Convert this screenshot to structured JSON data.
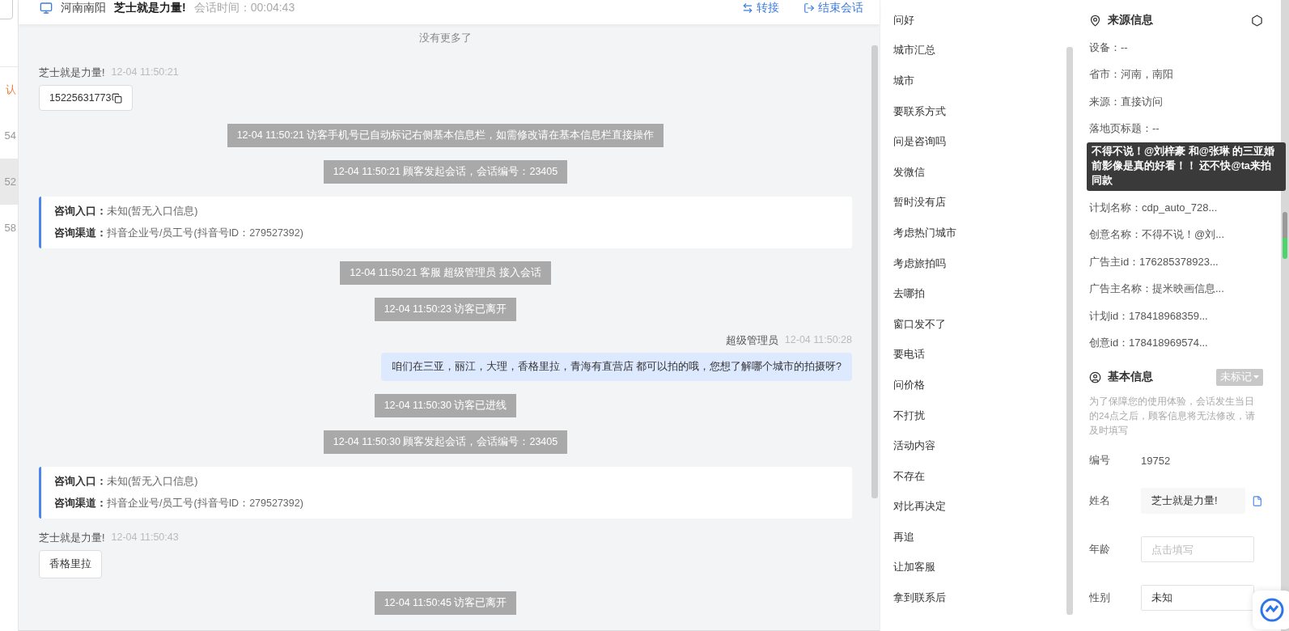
{
  "left_list": {
    "items": [
      {
        "text": "认",
        "kind": "alert",
        "selected": false
      },
      {
        "text": "54",
        "kind": "plain",
        "selected": false
      },
      {
        "text": "52",
        "kind": "plain",
        "selected": true
      },
      {
        "text": "58",
        "kind": "plain",
        "selected": false
      }
    ]
  },
  "header": {
    "location": "河南南阳",
    "customer": "芝士就是力量!",
    "duration": "会话时间：00:04:43",
    "actions": [
      {
        "label": "转接",
        "kind": "transfer"
      },
      {
        "label": "结束会话",
        "kind": "end"
      }
    ]
  },
  "messages": [
    {
      "kind": "notice",
      "text": "没有更多了"
    },
    {
      "kind": "visitor",
      "name": "芝士就是力量!",
      "time": "12-04 11:50:21",
      "text": "15225631773",
      "copy": true
    },
    {
      "kind": "system",
      "text": "12-04 11:50:21 访客手机号已自动标记右侧基本信息栏，如需修改请在基本信息栏直接操作"
    },
    {
      "kind": "system",
      "text": "12-04 11:50:21 顾客发起会话，会话编号：23405"
    },
    {
      "kind": "info",
      "rows": [
        {
          "label": "咨询入口：",
          "value": "未知(暂无入口信息)"
        },
        {
          "label": "咨询渠道：",
          "value": "抖音企业号/员工号(抖音号ID：279527392)"
        }
      ]
    },
    {
      "kind": "system",
      "text": "12-04 11:50:21 客服 超级管理员 接入会话"
    },
    {
      "kind": "system",
      "text": "12-04 11:50:23 访客已离开"
    },
    {
      "kind": "agent",
      "name": "超级管理员",
      "time": "12-04 11:50:28",
      "text": "咱们在三亚，丽江，大理，香格里拉，青海有直营店 都可以拍的哦，您想了解哪个城市的拍摄呀?"
    },
    {
      "kind": "system",
      "text": "12-04 11:50:30 访客已进线"
    },
    {
      "kind": "system",
      "text": "12-04 11:50:30 顾客发起会话，会话编号：23405"
    },
    {
      "kind": "info",
      "rows": [
        {
          "label": "咨询入口：",
          "value": "未知(暂无入口信息)"
        },
        {
          "label": "咨询渠道：",
          "value": "抖音企业号/员工号(抖音号ID：279527392)"
        }
      ]
    },
    {
      "kind": "visitor",
      "name": "芝士就是力量!",
      "time": "12-04 11:50:43",
      "text": "香格里拉",
      "copy": false
    },
    {
      "kind": "system",
      "text": "12-04 11:50:45 访客已离开"
    }
  ],
  "quick_replies": [
    "问好",
    "城市汇总",
    "城市",
    "要联系方式",
    "问是咨询吗",
    "发微信",
    "暂时没有店",
    "考虑热门城市",
    "考虑旅拍吗",
    "去哪拍",
    "窗口发不了",
    "要电话",
    "问价格",
    "不打扰",
    "活动内容",
    "不存在",
    "对比再决定",
    "再追",
    "让加客服",
    "拿到联系后"
  ],
  "source_info": {
    "title": "来源信息",
    "rows": [
      "设备：--",
      "省市：河南，南阳",
      "来源：直接访问",
      "落地页标题：--",
      "计划名称：cdp_auto_728...",
      "创意名称：不得不说！@刘...",
      "广告主id：176285378923...",
      "广告主名称：提米映画信息...",
      "计划id：178418968359...",
      "创意id：178418969574..."
    ],
    "tooltip": "不得不说！@刘梓豪 和@张琳 的三亚婚前影像是真的好看！！ 还不快@ta来拍同款"
  },
  "basic_info": {
    "title": "基本信息",
    "tag": "未标记",
    "note": "为了保障您的使用体验，会话发生当日的24点之后，顾客信息将无法修改，请及时填写",
    "fields": [
      {
        "label": "编号",
        "kind": "static",
        "value": "19752"
      },
      {
        "label": "姓名",
        "kind": "readonly",
        "value": "芝士就是力量!"
      },
      {
        "label": "年龄",
        "kind": "input",
        "placeholder": "点击填写"
      },
      {
        "label": "性别",
        "kind": "input",
        "value": "未知"
      }
    ]
  }
}
